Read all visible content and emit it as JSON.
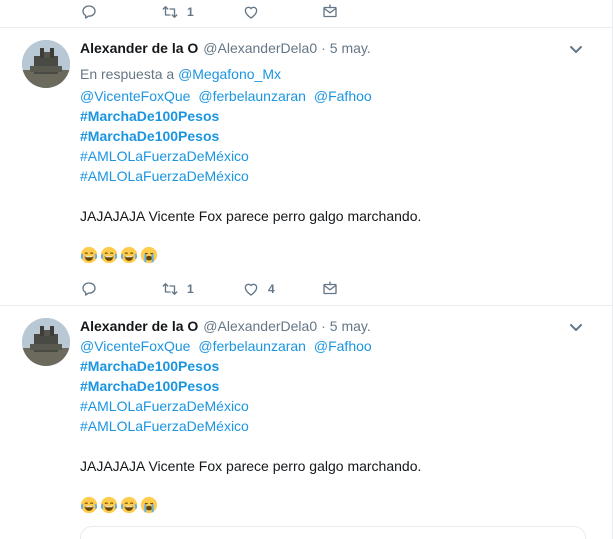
{
  "top_actions": {
    "retweet_count": "1",
    "like_count": ""
  },
  "tweets": [
    {
      "name": "Alexander de la O",
      "handle": "@AlexanderDela0",
      "time": "5 may.",
      "reply_prefix": "En respuesta a",
      "reply_to": "@Megafono_Mx",
      "mentions": [
        "@VicenteFoxQue",
        "@ferbelaunzaran",
        "@Fafhoo"
      ],
      "hashtags_bold": [
        "#MarchaDe100Pesos",
        "#MarchaDe100Pesos"
      ],
      "hashtags": [
        "#AMLOLaFuerzaDeMéxico",
        "#AMLOLaFuerzaDeMéxico"
      ],
      "text": "JAJAJAJA Vicente Fox parece perro galgo marchando.",
      "emojis": [
        "face-with-tears-of-joy",
        "face-with-tears-of-joy",
        "face-with-tears-of-joy",
        "loudly-crying-face"
      ],
      "actions": {
        "retweet_count": "1",
        "like_count": "4"
      }
    },
    {
      "name": "Alexander de la O",
      "handle": "@AlexanderDela0",
      "time": "5 may.",
      "mentions": [
        "@VicenteFoxQue",
        "@ferbelaunzaran",
        "@Fafhoo"
      ],
      "hashtags_bold": [
        "#MarchaDe100Pesos",
        "#MarchaDe100Pesos"
      ],
      "hashtags": [
        "#AMLOLaFuerzaDeMéxico",
        "#AMLOLaFuerzaDeMéxico"
      ],
      "text": "JAJAJAJA Vicente Fox parece perro galgo marchando.",
      "emojis": [
        "face-with-tears-of-joy",
        "face-with-tears-of-joy",
        "face-with-tears-of-joy",
        "loudly-crying-face"
      ]
    }
  ],
  "colors": {
    "link": "#1b95e0",
    "secondary": "#657786",
    "border": "#e6ecf0"
  }
}
